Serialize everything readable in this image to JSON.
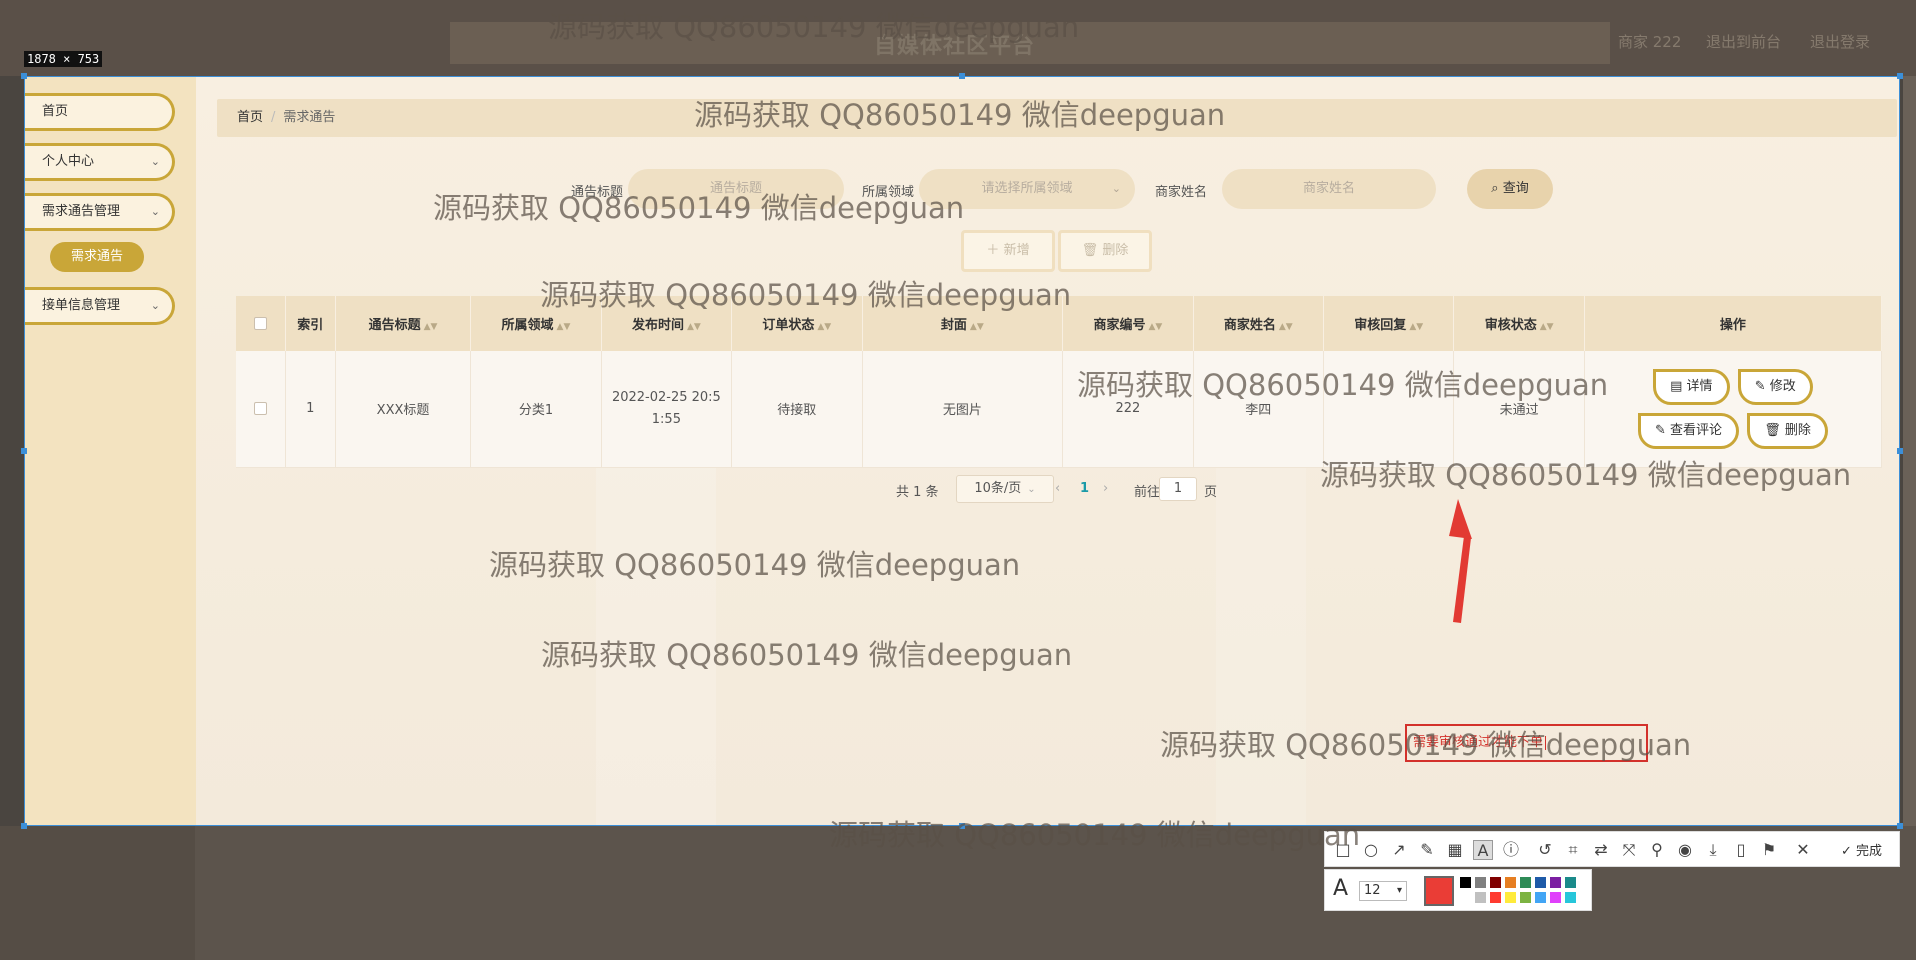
{
  "background_app": {
    "title": "自媒体社区平台",
    "links": [
      "商家 222",
      "退出到前台",
      "退出登录"
    ]
  },
  "capture_size": "1878 × 753",
  "sidebar": {
    "items": [
      {
        "label": "首页",
        "chevron": ""
      },
      {
        "label": "个人中心",
        "chevron": "⌄"
      },
      {
        "label": "需求通告管理",
        "chevron": "⌄"
      },
      {
        "label": "接单信息管理",
        "chevron": "⌄"
      }
    ],
    "active_sub": "需求通告"
  },
  "breadcrumb": {
    "home": "首页",
    "sep": "/",
    "current": "需求通告"
  },
  "filters": {
    "title_label": "通告标题",
    "title_placeholder": "通告标题",
    "domain_label": "所属领域",
    "domain_placeholder": "请选择所属领域",
    "merchant_label": "商家姓名",
    "merchant_placeholder": "商家姓名",
    "query_label": "查询",
    "query_icon": "search-icon"
  },
  "actions": {
    "add_label": "新增",
    "add_icon": "plus-icon",
    "delete_label": "删除",
    "delete_icon": "trash-icon"
  },
  "table": {
    "headers": [
      "索引",
      "通告标题",
      "所属领域",
      "发布时间",
      "订单状态",
      "封面",
      "商家编号",
      "商家姓名",
      "审核回复",
      "审核状态",
      "操作"
    ],
    "rows": [
      {
        "index": "1",
        "title": "XXX标题",
        "domain": "分类1",
        "time_line1": "2022-02-25 20:5",
        "time_line2": "1:55",
        "order_status": "待接取",
        "cover": "无图片",
        "merchant_no": "222",
        "merchant_name": "李四",
        "review_reply": "",
        "review_status": "未通过"
      }
    ],
    "row_actions": {
      "detail": "详情",
      "edit": "修改",
      "view_comments": "查看评论",
      "delete": "删除"
    }
  },
  "pagination": {
    "total": "共 1 条",
    "page_size": "10条/页",
    "prev": "‹",
    "current": "1",
    "next": "›",
    "goto_prefix": "前往",
    "goto_value": "1",
    "goto_suffix": "页"
  },
  "annotation": {
    "text": "需要审核通过才能下单",
    "color": "#d3312b"
  },
  "screenshot_tool": {
    "done_label": "完成",
    "font_size": "12",
    "current_color": "#ea3d36",
    "tools": [
      "rect-icon",
      "ellipse-icon",
      "arrow-icon",
      "pen-icon",
      "mosaic-icon",
      "text-icon",
      "number-icon",
      "undo-icon",
      "ocr-icon",
      "translate-icon",
      "scroll-capture-icon",
      "pin-icon",
      "record-icon",
      "download-icon",
      "save-phone-icon",
      "bookmark-icon",
      "close-icon"
    ],
    "palette": [
      "#000000",
      "#808080",
      "#800000",
      "#e67e22",
      "#2e8b57",
      "#1e5aa8",
      "#7b1fa2",
      "#1a8a8a",
      "#ffffff",
      "#c0c0c0",
      "#ff3b30",
      "#ffeb3b",
      "#7cb342",
      "#42a5f5",
      "#e040fb",
      "#26c6da"
    ]
  },
  "watermark": "源码获取 QQ86050149 微信deepguan"
}
